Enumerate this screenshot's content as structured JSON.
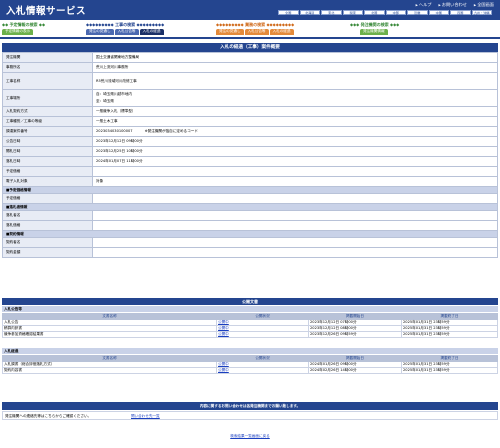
{
  "header": {
    "title": "入札情報サービス",
    "links": [
      "ヘルプ",
      "お問い合わせ",
      "全国画面"
    ],
    "regions": [
      "全国",
      "北海道",
      "東北",
      "関東",
      "北陸",
      "中部",
      "近畿",
      "中国",
      "四国",
      "九州・沖縄"
    ]
  },
  "nav": {
    "groups": [
      {
        "title": "◆◆ 予定情報の検索 ◆◆",
        "buttons": [
          "予定情報の表示"
        ]
      },
      {
        "title": "◆◆◆◆◆◆◆◆◆ 工事の検索 ◆◆◆◆◆◆◆◆◆",
        "buttons": [
          "発注の見通し",
          "入札公告等",
          "入札の経過"
        ]
      },
      {
        "title": "◆◆◆◆◆◆◆◆◆ 業務の検索 ◆◆◆◆◆◆◆◆◆",
        "buttons": [
          "発注の見通し",
          "入札公告等",
          "入札の経過"
        ]
      },
      {
        "title": "◆◆◆ 発注機関の検索 ◆◆◆",
        "buttons": [
          "発注機関情報"
        ]
      }
    ]
  },
  "main": {
    "section_title": "入札の経過（工事）案件概要",
    "rows": [
      {
        "label": "発注機関",
        "value": "国土交通省関東地方整備局"
      },
      {
        "label": "事務所名",
        "value": "荒川上流河川事務所"
      },
      {
        "label": "工事名称",
        "value": "R5荒川流域河川改修工事"
      },
      {
        "label": "工事場所",
        "value": "自：埼玉県川越市地内",
        "value2": "至：埼玉県"
      },
      {
        "label": "入札契約方式",
        "value": "一般競争入札（標準型）"
      },
      {
        "label": "工事種別／工事の等級",
        "value": "一般土木工事"
      },
      {
        "label": "調達案件番号",
        "value": "2023034030100007",
        "note": "※発注機関が独自に定めるコード"
      },
      {
        "label": "公告日時",
        "value": "2023年12月12日 09時00分"
      },
      {
        "label": "開札日時",
        "value": "2023年12月25日 10時00分"
      },
      {
        "label": "落札日時",
        "value": "2024年01月07日 11時00分"
      },
      {
        "label": "予定価格",
        "value": ""
      },
      {
        "label": "電子入札対象",
        "value": "対象"
      }
    ],
    "sub1": "■予定価格情報",
    "sub1_rows": [
      {
        "label": "予定価格",
        "value": ""
      }
    ],
    "sub2": "■落札者情報",
    "sub2_rows": [
      {
        "label": "落札者名",
        "value": ""
      },
      {
        "label": "落札価格",
        "value": ""
      }
    ],
    "sub3": "■契約情報",
    "sub3_rows": [
      {
        "label": "契約者名",
        "value": ""
      },
      {
        "label": "契約金額",
        "value": ""
      }
    ]
  },
  "documents": {
    "title": "公開文書",
    "koukoku": {
      "label": "入札公告等",
      "headers": [
        "文書名称",
        "公開状況",
        "掲載開始日",
        "掲載終了日"
      ],
      "rows": [
        [
          "入札公告",
          "公開中",
          "2023年12月12日 07時00分",
          "2025年01月31日 23時59分"
        ],
        [
          "積算内訳書",
          "公開中",
          "2023年12月12日 08時00分",
          "2025年01月31日 23時59分"
        ],
        [
          "競争参加資格確認結果書",
          "公開中",
          "2023年12月26日 09時59分",
          "2025年01月31日 23時59分"
        ]
      ]
    },
    "keika": {
      "label": "入札経過",
      "headers": [
        "文書名称",
        "公開状況",
        "掲載開始日",
        "掲載終了日"
      ],
      "rows": [
        [
          "入札調書（総合評価落札方式）",
          "公開中",
          "2024年01月26日 09時00分",
          "2025年01月31日 23時59分"
        ],
        [
          "契約内容書",
          "公開中",
          "2024年02月26日 14時00分",
          "2025年01月31日 23時59分"
        ]
      ]
    }
  },
  "contact": {
    "title": "内容に関するお問い合わせは各発注機関までお願い致します。",
    "text": "発注機関への連絡先等はこちらからご確認ください。",
    "link": "問い合わせ先一覧"
  },
  "back_link": "検索結果一覧画面に戻る"
}
